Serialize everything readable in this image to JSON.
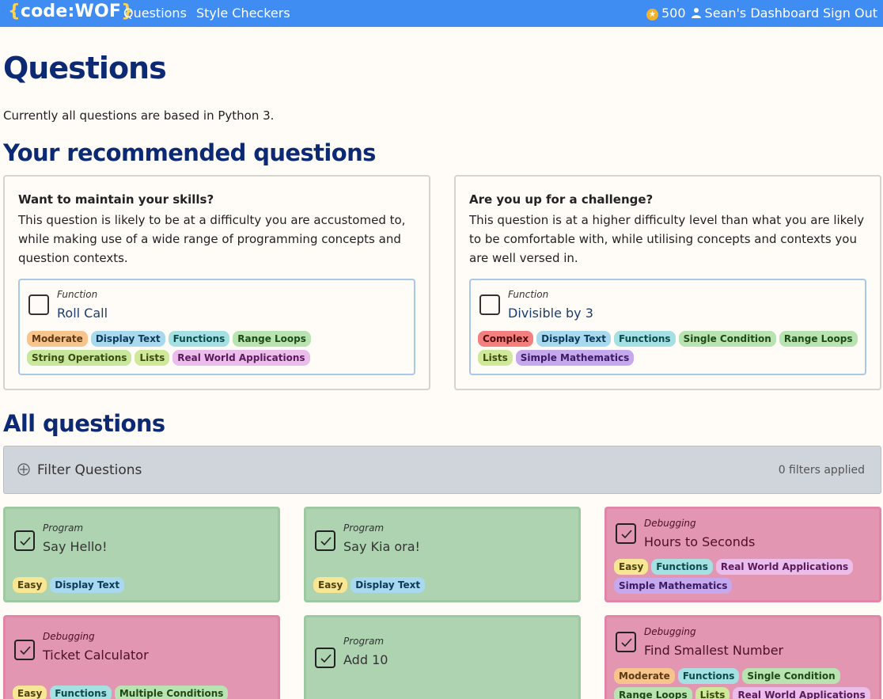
{
  "navbar": {
    "brand_open": "{",
    "brand_text": "code:WOF",
    "brand_close": "}",
    "links": [
      "Questions",
      "Style Checkers"
    ],
    "points": "500",
    "dashboard": "Sean's Dashboard",
    "sign_out": "Sign Out"
  },
  "page": {
    "title": "Questions",
    "intro": "Currently all questions are based in Python 3.",
    "recommended_title": "Your recommended questions",
    "all_title": "All questions"
  },
  "recommended": [
    {
      "heading": "Want to maintain your skills?",
      "description": "This question is likely to be at a difficulty you are accustomed to, while making use of a wide range of programming concepts and question contexts.",
      "question": {
        "type": "Function",
        "title": "Roll Call",
        "tags": [
          "Moderate",
          "Display Text",
          "Functions",
          "Range Loops",
          "String Operations",
          "Lists",
          "Real World Applications"
        ]
      }
    },
    {
      "heading": "Are you up for a challenge?",
      "description": "This question is at a higher difficulty level than what you are likely to be comfortable with, while utilising concepts and contexts you are well versed in.",
      "question": {
        "type": "Function",
        "title": "Divisible by 3",
        "tags": [
          "Complex",
          "Display Text",
          "Functions",
          "Single Condition",
          "Range Loops",
          "Lists",
          "Simple Mathematics"
        ]
      }
    }
  ],
  "filter": {
    "label": "Filter Questions",
    "count": "0 filters applied"
  },
  "questions": [
    {
      "type": "Program",
      "title": "Say Hello!",
      "tags": [
        "Easy",
        "Display Text"
      ]
    },
    {
      "type": "Program",
      "title": "Say Kia ora!",
      "tags": [
        "Easy",
        "Display Text"
      ]
    },
    {
      "type": "Debugging",
      "title": "Hours to Seconds",
      "tags": [
        "Easy",
        "Functions",
        "Real World Applications",
        "Simple Mathematics"
      ]
    },
    {
      "type": "Debugging",
      "title": "Ticket Calculator",
      "tags": [
        "Easy",
        "Functions",
        "Multiple Conditions"
      ]
    },
    {
      "type": "Program",
      "title": "Add 10",
      "tags": []
    },
    {
      "type": "Debugging",
      "title": "Find Smallest Number",
      "tags": [
        "Moderate",
        "Functions",
        "Single Condition",
        "Range Loops",
        "Lists",
        "Real World Applications"
      ]
    }
  ],
  "colors": {
    "navbar": "#3f8cf3",
    "brand_brace": "#ffd34c",
    "heading": "#0c2a74",
    "solved_card": "#aed3b1",
    "debug_card": "#e396b2"
  }
}
